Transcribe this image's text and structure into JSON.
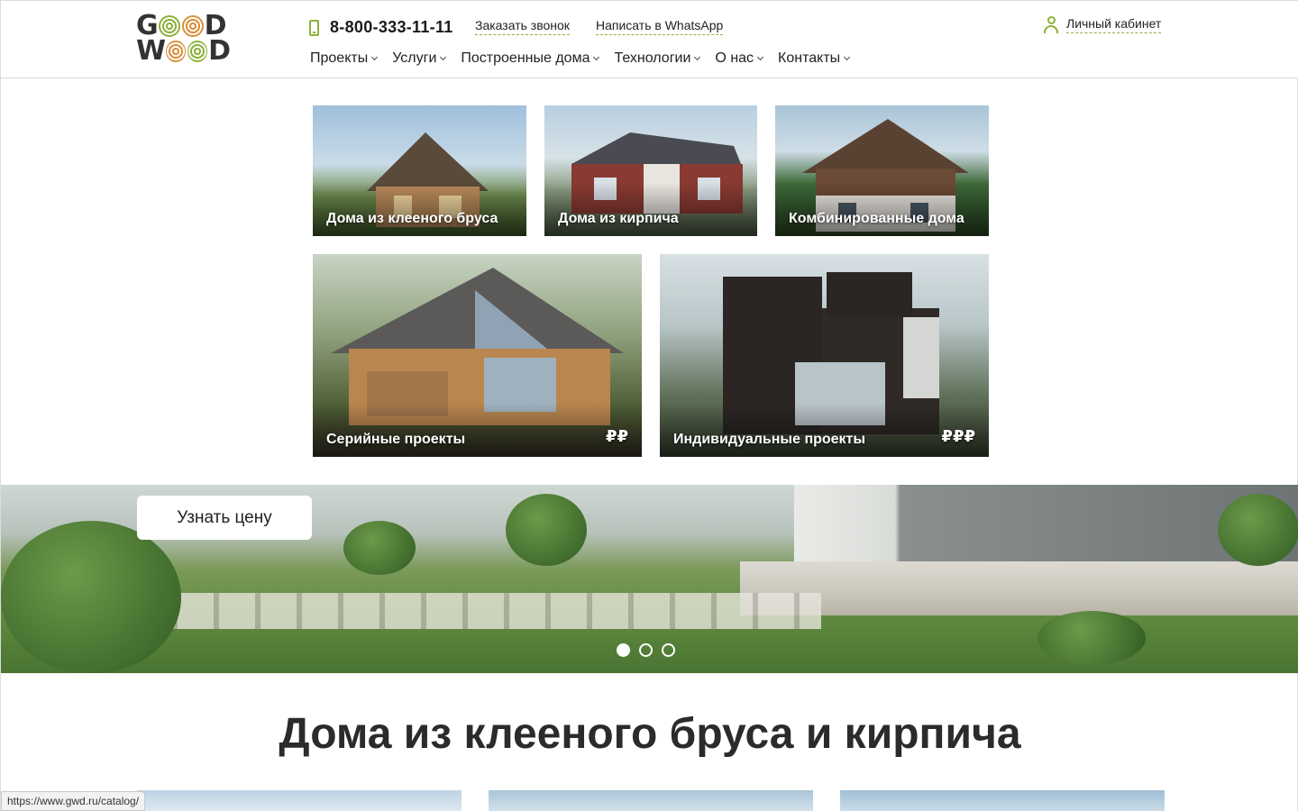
{
  "header": {
    "logo_line1": "GOOD",
    "logo_line2": "WOOD",
    "phone": "8-800-333-11-11",
    "callback_link": "Заказать звонок",
    "whatsapp_link": "Написать в WhatsApp",
    "account_label": "Личный кабинет",
    "nav": [
      "Проекты",
      "Услуги",
      "Построенные дома",
      "Технологии",
      "О нас",
      "Контакты"
    ]
  },
  "categories": [
    {
      "label": "Дома из клееного бруса"
    },
    {
      "label": "Дома из кирпича"
    },
    {
      "label": "Комбинированные дома"
    },
    {
      "label": "Серийные проекты",
      "price": "₽₽"
    },
    {
      "label": "Индивидуальные проекты",
      "price": "₽₽₽"
    }
  ],
  "banner": {
    "cta_label": "Узнать цену",
    "slides_total": 3,
    "active_slide": 1
  },
  "section": {
    "title": "Дома из клееного бруса и кирпича"
  },
  "status_bar": {
    "url": "https://www.gwd.ru/catalog/"
  },
  "colors": {
    "accent": "#8cb23a",
    "logo_orange": "#d98f3a"
  }
}
